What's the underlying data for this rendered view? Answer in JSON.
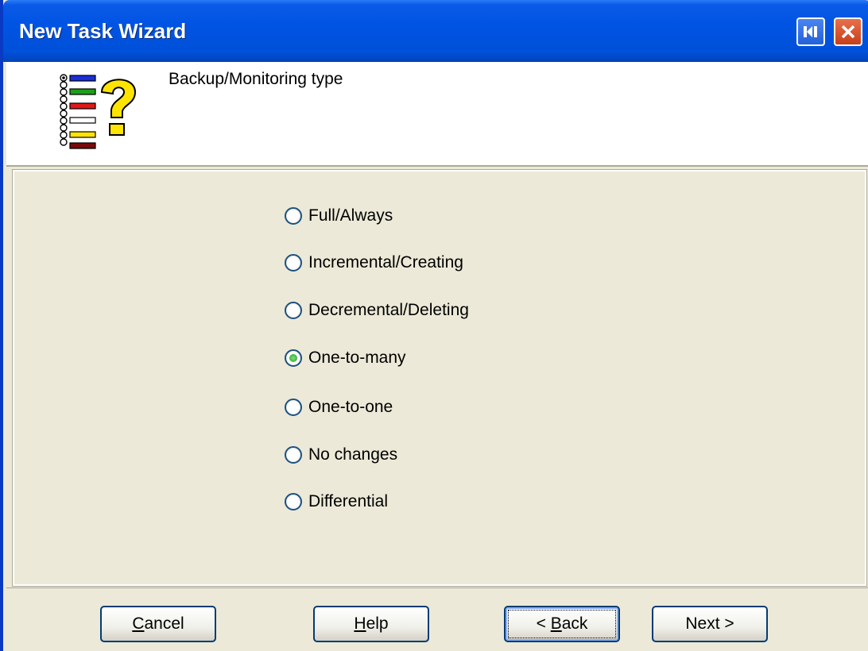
{
  "window": {
    "title": "New Task Wizard"
  },
  "header": {
    "title": "Backup/Monitoring type",
    "icon": "wizard-list-question-icon"
  },
  "options": [
    {
      "label": "Full/Always",
      "selected": false
    },
    {
      "label": "Incremental/Creating",
      "selected": false
    },
    {
      "label": "Decremental/Deleting",
      "selected": false
    },
    {
      "label": "One-to-many",
      "selected": true
    },
    {
      "label": "One-to-one",
      "selected": false
    },
    {
      "label": "No changes",
      "selected": false
    },
    {
      "label": "Differential",
      "selected": false
    }
  ],
  "footer": {
    "cancel_pre": "",
    "cancel_key": "C",
    "cancel_post": "ancel",
    "help_pre": "",
    "help_key": "H",
    "help_post": "elp",
    "back_pre": "< ",
    "back_key": "B",
    "back_post": "ack",
    "next_label": "Next >"
  },
  "colors": {
    "titlebar": "#0054e3",
    "selected_dot": "#21a121",
    "radio_border": "#1c5180"
  }
}
